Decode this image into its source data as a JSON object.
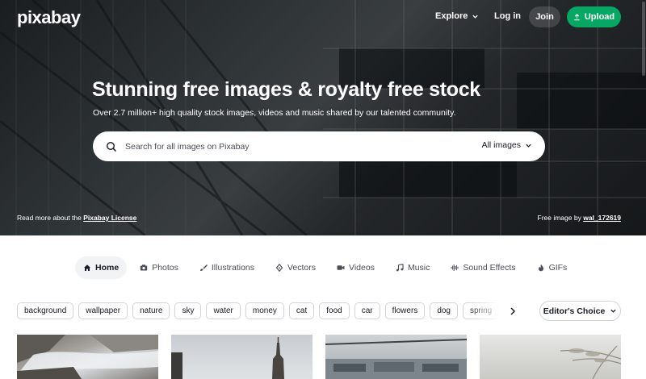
{
  "header": {
    "logo": "pixabay",
    "explore": "Explore",
    "login": "Log in",
    "join": "Join",
    "upload": "Upload"
  },
  "hero": {
    "title": "Stunning free images & royalty free stock",
    "subtitle": "Over 2.7 million+ high quality stock images, videos and music shared by our talented community.",
    "search_placeholder": "Search for all images on Pixabay",
    "search_type": "All images",
    "license_prefix": "Read more about the ",
    "license_link": "Pixabay License",
    "credit_prefix": "Free image by ",
    "credit_user": "wal_172619"
  },
  "tabs": [
    {
      "label": "Home",
      "icon": "home-icon",
      "active": true
    },
    {
      "label": "Photos",
      "icon": "camera-icon"
    },
    {
      "label": "Illustrations",
      "icon": "brush-icon"
    },
    {
      "label": "Vectors",
      "icon": "pen-nib-icon"
    },
    {
      "label": "Videos",
      "icon": "video-icon"
    },
    {
      "label": "Music",
      "icon": "music-note-icon"
    },
    {
      "label": "Sound Effects",
      "icon": "sound-wave-icon"
    },
    {
      "label": "GIFs",
      "icon": "flame-icon"
    }
  ],
  "chips": [
    "background",
    "wallpaper",
    "nature",
    "sky",
    "water",
    "money",
    "cat",
    "food",
    "car",
    "flowers",
    "dog",
    "spring"
  ],
  "editor_choice": "Editor's Choice",
  "colors": {
    "accent": "#04a862",
    "text": "#191b26",
    "muted": "#4b4d57",
    "border": "#d2d4da"
  }
}
